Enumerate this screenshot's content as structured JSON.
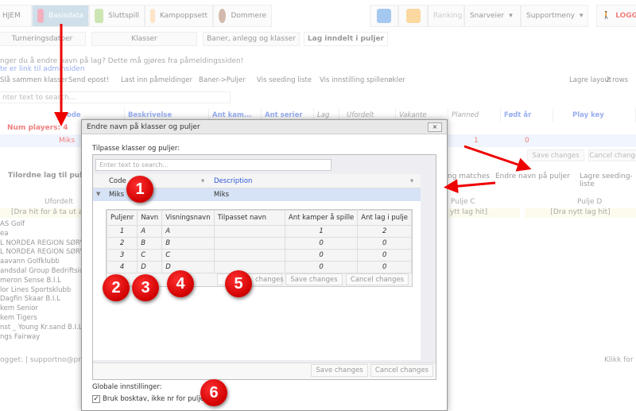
{
  "nav": {
    "items": [
      "HJEM",
      "Basisdata",
      "Sluttspill",
      "Kampoppsett",
      "Dommere"
    ],
    "ranking": "Ranking",
    "snarveier": "Snarveier",
    "supportmeny": "Supportmeny",
    "logout": "LOGG"
  },
  "tabs": [
    "Turneringsdatoer",
    "Klasser",
    "Baner, anlegg og klasser",
    "Lag inndelt i puljer"
  ],
  "notice": {
    "line1": "nger du å endre navn på lag? Dette må gjøres fra påmeldingssiden!",
    "line2": "te er link til adminsiden"
  },
  "toolbar": {
    "items": [
      "Slå sammen klasser",
      "Send epost!",
      "Last inn påmeldinger",
      "Baner->Puljer",
      "Vis seeding liste",
      "Vis innstilling spillenøkler"
    ],
    "lagre_layout": "Lagre layout",
    "rows": "2 rows"
  },
  "search_placeholder": "nter text to search...",
  "grid": {
    "headers": [
      "ode",
      "Beskrivelse",
      "Ant kam...",
      "Ant serier",
      "Lag",
      "Ufordelt",
      "Vakante",
      "Planned",
      "Født år",
      "Play key"
    ],
    "group": "Num players: 4",
    "row": {
      "code": "Miks",
      "planned": "1",
      "fodt": "0"
    },
    "save": "Save changes",
    "cancel": "Cancel changes"
  },
  "pool_toolbar": {
    "title": "Tilordne lag til puljer",
    "matches": "ng matches",
    "rename": "Endre navn på puljer",
    "seeding": "Lagre seeding-liste"
  },
  "pools": {
    "ufordelt": "Ufordelt",
    "ufordelt_drop": "[Dra hit for å ta ut av p",
    "pulje_c": "Pulje C",
    "pulje_d": "Pulje D",
    "drop": "[Dra nytt lag hit]",
    "drop_c": "ytt lag hit]"
  },
  "teams": [
    "AS Golf",
    "ea",
    "L NORDEA REGION SØRVES",
    "L NORDEA REGION SØRVES",
    "aavann Golfklubb",
    "andsdal Group Bedriftsidrett",
    "meron Sense B.I.L",
    "lor Lines Sportsklubb",
    "Dagfin Skaar B.I.L",
    "kem Senior",
    "kem Tigers",
    "nst _ Young Kr.sand B.I.L",
    "ngs Fairway"
  ],
  "footer": {
    "left": "ogget: | supportno@profixi",
    "right": "Klikk for"
  },
  "dialog": {
    "title": "Endre navn på klasser og puljer",
    "close": "×",
    "subtitle": "Tilpasse klasser og puljer:",
    "search_placeholder": "Enter text to search...",
    "headers": {
      "code": "Code",
      "description": "Description"
    },
    "row": {
      "code": "Miks",
      "description": "Miks"
    },
    "detail_headers": [
      "Puljenr",
      "Navn",
      "Visningsnavn",
      "Tilpasset navn",
      "Ant kamper å spille",
      "Ant lag i pulje"
    ],
    "detail_rows": [
      [
        "1",
        "A",
        "A",
        "",
        "1",
        "2"
      ],
      [
        "2",
        "B",
        "B",
        "",
        "0",
        "0"
      ],
      [
        "3",
        "C",
        "C",
        "",
        "0",
        "0"
      ],
      [
        "4",
        "D",
        "D",
        "",
        "0",
        "0"
      ]
    ],
    "detail_buttons": [
      "changes",
      "Save changes",
      "Cancel changes"
    ],
    "save": "Save changes",
    "cancel": "Cancel changes",
    "global": "Globale innstillinger:",
    "checkbox": "Bruk bosktav, ikke nr for pulje (av)"
  },
  "badges": [
    "1",
    "2",
    "3",
    "4",
    "5",
    "6"
  ],
  "colors": {
    "accent": "#4a6fe0",
    "selected": "#d6e2f5",
    "badge": "#e00000",
    "arrow": "#ee0000"
  }
}
